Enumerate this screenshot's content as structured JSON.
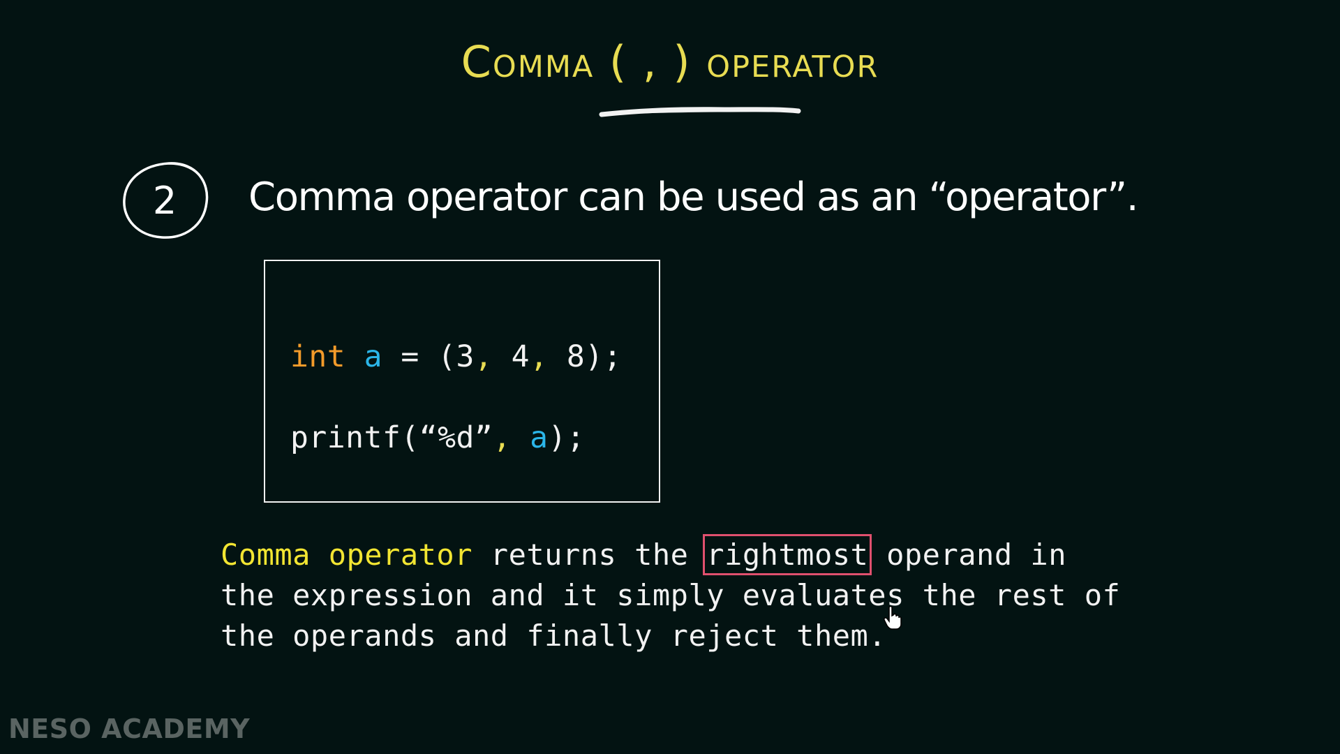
{
  "slide": {
    "title": "Comma ( , ) operator",
    "step_number": "2",
    "heading": "Comma operator can be used as an “operator”.",
    "code": {
      "line1": {
        "keyword": "int",
        "space1": " ",
        "variable": "a",
        "middle": " = (3",
        "comma1": ",",
        "mid2": " 4",
        "comma2": ",",
        "end": " 8);"
      },
      "line2": {
        "start": "printf(“%d”",
        "comma": ",",
        "space": " ",
        "variable": "a",
        "end": ");"
      }
    },
    "description": {
      "highlight": "Comma operator",
      "part1": " returns the ",
      "boxed": "rightmost",
      "part2": " operand in",
      "line2": "the expression and it simply evaluates the rest of",
      "line3": "the operands and finally reject them."
    },
    "brand": "NESO ACADEMY"
  },
  "colors": {
    "background": "#031312",
    "title": "#e8dc52",
    "keyword": "#f39b2a",
    "variable": "#2bb5e8",
    "highlight": "#f2e532",
    "box": "#e0506e"
  }
}
